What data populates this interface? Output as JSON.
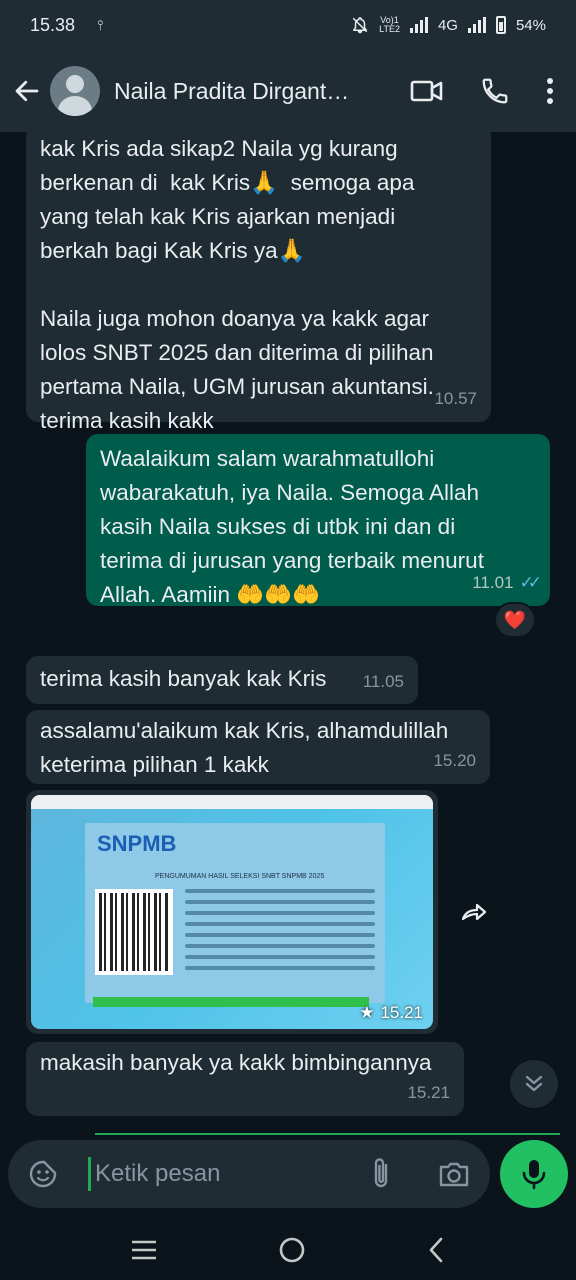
{
  "status_bar": {
    "time": "15.38",
    "network_label": "4G",
    "volte_line1": "Vo)1",
    "volte_line2": "LTE2",
    "battery": "54%"
  },
  "header": {
    "contact_name": "Naila Pradita Dirgant…"
  },
  "messages": [
    {
      "direction": "incoming",
      "text": "kak Kris ada sikap2 Naila yg kurang\nberkenan di  kak Kris🙏  semoga apa\nyang telah kak Kris ajarkan menjadi\nberkah bagi Kak Kris ya🙏\n\nNaila juga mohon doanya ya kakk agar\nlolos SNBT 2025 dan diterima di pilihan\npertama Naila, UGM jurusan akuntansi.\nterima kasih kakk",
      "time": "10.57"
    },
    {
      "direction": "outgoing",
      "text": "Waalaikum salam warahmatullohi\nwabarakatuh, iya Naila. Semoga Allah\nkasih Naila sukses di utbk ini dan di\nterima di jurusan yang terbaik menurut\nAllah. Aamiin 🤲🤲🤲",
      "time": "11.01",
      "reaction": "❤️"
    },
    {
      "direction": "incoming",
      "text": "terima kasih banyak kak Kris",
      "time": "11.05"
    },
    {
      "direction": "incoming",
      "text": "assalamu'alaikum kak Kris, alhamdulillah\nketerima pilihan 1 kakk",
      "time": "15.20"
    },
    {
      "direction": "incoming",
      "type": "image",
      "image_logo_text": "SNPMB",
      "image_heading": "PENGUMUMAN HASIL SELEKSI SNBT SNPMB 2025",
      "starred": true,
      "time": "15.21"
    },
    {
      "direction": "incoming",
      "text": "makasih banyak ya kakk bimbingannya",
      "time": "15.21"
    }
  ],
  "composer": {
    "placeholder": "Ketik pesan"
  },
  "colors": {
    "background": "#0b141a",
    "incoming_bubble": "#202c33",
    "outgoing_bubble": "#005c4b",
    "accent_green": "#21c063",
    "read_ticks": "#53bdeb"
  },
  "icons": [
    "back-arrow-icon",
    "video-call-icon",
    "phone-icon",
    "more-icon",
    "forward-icon",
    "star-icon",
    "double-chevron-down-icon",
    "sticker-icon",
    "attach-icon",
    "camera-icon",
    "mic-icon",
    "recents-icon",
    "home-icon",
    "back-icon"
  ]
}
